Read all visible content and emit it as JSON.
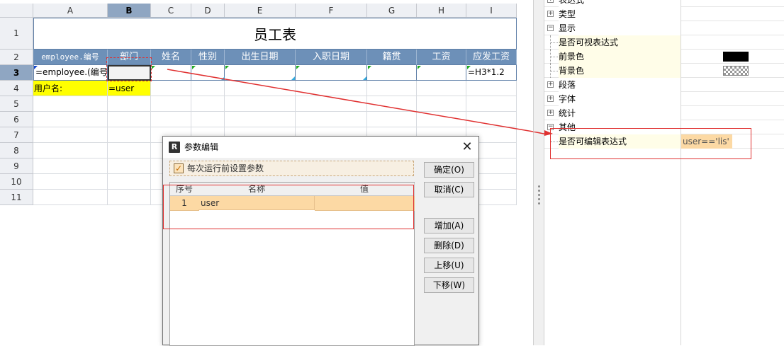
{
  "sheet": {
    "columns": [
      "A",
      "B",
      "C",
      "D",
      "E",
      "F",
      "G",
      "H",
      "I"
    ],
    "selected_column": "B",
    "rows": [
      "1",
      "2",
      "3",
      "4",
      "5",
      "6",
      "7",
      "8",
      "9",
      "10",
      "11"
    ],
    "selected_row": "3",
    "title": "员工表",
    "headers": [
      "employee.编号",
      "部门",
      "姓名",
      "性别",
      "出生日期",
      "入职日期",
      "籍贯",
      "工资",
      "应发工资"
    ],
    "row3": {
      "a": "=employee.(编号)",
      "i": "=H3*1.2"
    },
    "row4": {
      "a": "用户名:",
      "b": "=user"
    }
  },
  "props": {
    "items": [
      {
        "label": "表达式",
        "type": "group",
        "expanded": false,
        "value": ""
      },
      {
        "label": "类型",
        "type": "group",
        "expanded": false,
        "value": ""
      },
      {
        "label": "显示",
        "type": "group",
        "expanded": true,
        "value": ""
      },
      {
        "label": "是否可视表达式",
        "type": "leaf",
        "value": ""
      },
      {
        "label": "前景色",
        "type": "leaf",
        "value": "",
        "swatch": "#000000"
      },
      {
        "label": "背景色",
        "type": "leaf",
        "value": "",
        "swatch": "checker"
      },
      {
        "label": "段落",
        "type": "group",
        "expanded": false,
        "value": ""
      },
      {
        "label": "字体",
        "type": "group",
        "expanded": false,
        "value": ""
      },
      {
        "label": "统计",
        "type": "group",
        "expanded": false,
        "value": ""
      },
      {
        "label": "其他",
        "type": "group",
        "expanded": true,
        "value": ""
      },
      {
        "label": "是否可编辑表达式",
        "type": "leaf",
        "value": "user=='lis'"
      }
    ]
  },
  "dialog": {
    "title": "参数编辑",
    "checkbox_label": "每次运行前设置参数",
    "checkbox_checked": true,
    "table": {
      "headers": [
        "序号",
        "名称",
        "值"
      ],
      "rows": [
        {
          "index": "1",
          "name": "user",
          "value": ""
        }
      ]
    },
    "buttons": {
      "ok": "确定(O)",
      "cancel": "取消(C)",
      "add": "增加(A)",
      "delete": "删除(D)",
      "up": "上移(U)",
      "down": "下移(W)"
    }
  },
  "colors": {
    "header_blue": "#6d90b8",
    "annotation_red": "#e03131",
    "param_row": "#fcd9a4",
    "highlight_yellow": "#ffff00"
  }
}
